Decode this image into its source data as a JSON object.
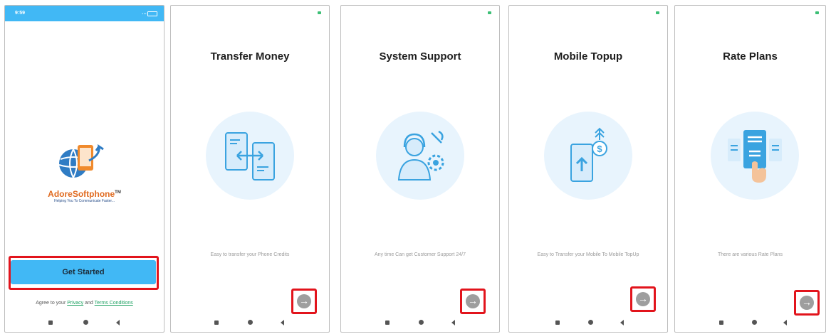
{
  "screen1": {
    "status_time": "9:59",
    "status_signal": "⻀⻀",
    "brand_name": "AdoreSoftphone",
    "brand_tm": "TM",
    "tagline": "Helping You To Communicate Faster...",
    "get_started_label": "Get Started",
    "agree_prefix": "Agree to your",
    "privacy_link": "Privacy",
    "and_text": "and",
    "terms_link": "Terms Conditions"
  },
  "slides": [
    {
      "title": "Transfer Money",
      "description": "Easy to transfer your Phone Credits",
      "illustration": "phones-transfer-arrows-icon"
    },
    {
      "title": "System Support",
      "description": "Any time Can get Customer Support 24/7",
      "illustration": "support-agent-gear-icon"
    },
    {
      "title": "Mobile Topup",
      "description": "Easy to Transfer your Mobile To Mobile TopUp",
      "illustration": "phone-topup-dollar-icon"
    },
    {
      "title": "Rate Plans",
      "description": "There are various Rate Plans",
      "illustration": "rate-plans-hand-icon"
    }
  ],
  "next_button_glyph": "→",
  "colors": {
    "accent_blue": "#41b8f5",
    "highlight_red": "#e2141c",
    "next_button_grey": "#9e9e9e",
    "illustration_circle": "#e8f4fd",
    "brand_orange": "#e06b21",
    "link_green": "#1da061"
  }
}
